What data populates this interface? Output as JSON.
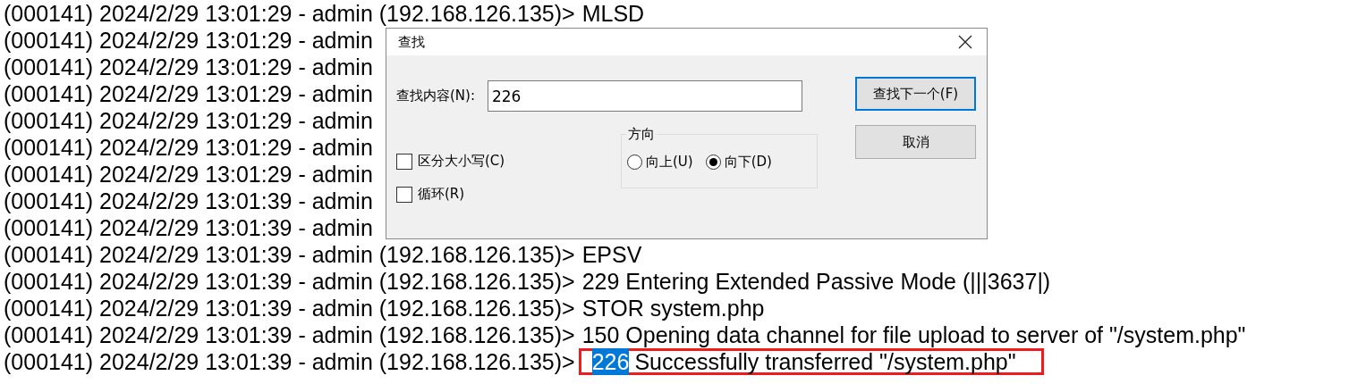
{
  "log": {
    "lines": [
      {
        "prefix": "(000141) 2024/2/29 13:01:29 - admin (192.168.126.135)>",
        "message": "MLSD"
      },
      {
        "prefix": "(000141) 2024/2/29 13:01:29 - admin"
      },
      {
        "prefix": "(000141) 2024/2/29 13:01:29 - admin"
      },
      {
        "prefix": "(000141) 2024/2/29 13:01:29 - admin"
      },
      {
        "prefix": "(000141) 2024/2/29 13:01:29 - admin"
      },
      {
        "prefix": "(000141) 2024/2/29 13:01:29 - admin"
      },
      {
        "prefix": "(000141) 2024/2/29 13:01:29 - admin"
      },
      {
        "prefix": "(000141) 2024/2/29 13:01:39 - admin"
      },
      {
        "prefix": "(000141) 2024/2/29 13:01:39 - admin"
      },
      {
        "prefix": "(000141) 2024/2/29 13:01:39 - admin (192.168.126.135)>",
        "message": "EPSV"
      },
      {
        "prefix": "(000141) 2024/2/29 13:01:39 - admin (192.168.126.135)>",
        "message": "229 Entering Extended Passive Mode (|||3637|)"
      },
      {
        "prefix": "(000141) 2024/2/29 13:01:39 - admin (192.168.126.135)>",
        "message": "STOR system.php"
      },
      {
        "prefix": "(000141) 2024/2/29 13:01:39 - admin (192.168.126.135)>",
        "message": "150 Opening data channel for file upload to server of \"/system.php\""
      },
      {
        "prefix": "(000141) 2024/2/29 13:01:39 - admin (192.168.126.135)>",
        "match": "226",
        "message": "Successfully transferred \"/system.php\"",
        "marked": true
      }
    ]
  },
  "dialog": {
    "title": "查找",
    "find_label": "查找内容(N):",
    "find_value": "226",
    "buttons": [
      {
        "label": "查找下一个(F)",
        "default": true
      },
      {
        "label": "取消",
        "default": false
      }
    ],
    "direction": {
      "legend": "方向",
      "options": [
        {
          "label": "向上(U)",
          "selected": false
        },
        {
          "label": "向下(D)",
          "selected": true
        }
      ]
    },
    "checkboxes": [
      {
        "label": "区分大小写(C)",
        "checked": false
      },
      {
        "label": "循环(R)",
        "checked": false
      }
    ]
  }
}
